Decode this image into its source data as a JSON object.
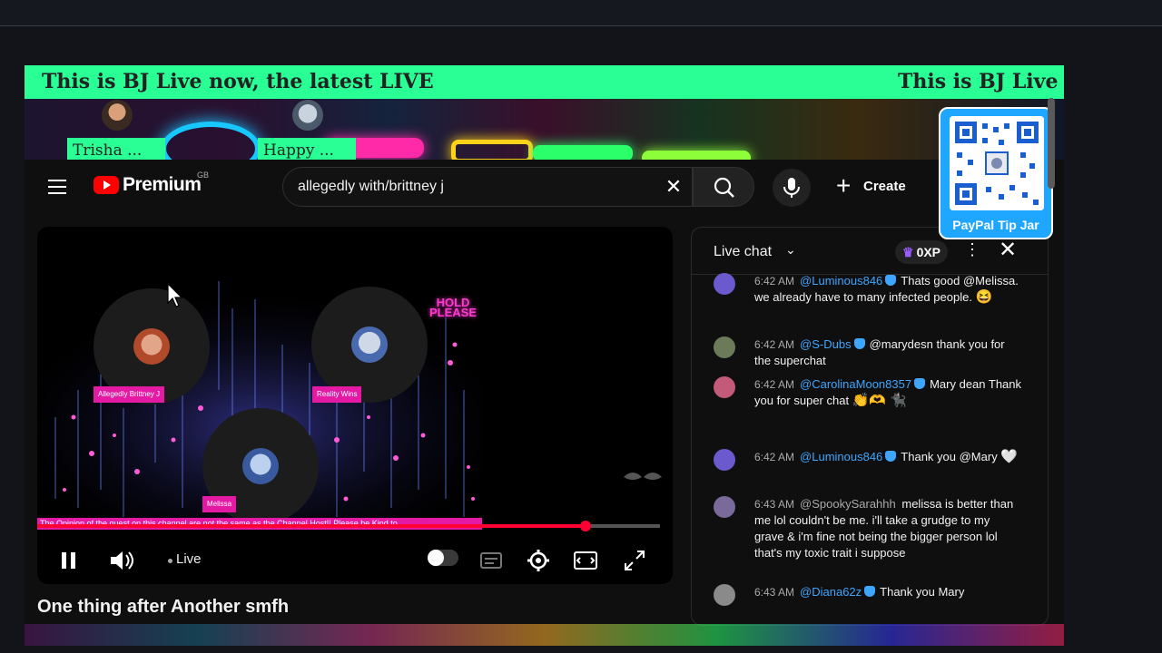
{
  "overlay": {
    "ticker_text_a": "This is BJ Live now, the latest LIVE",
    "ticker_text_b": "This is BJ Live",
    "guests_top": [
      {
        "name": "Trisha ..."
      },
      {
        "name": "Happy ..."
      }
    ],
    "qr_label": "PayPal Tip Jar"
  },
  "header": {
    "logo_text": "Premium",
    "logo_region": "GB",
    "search_value": "allegedly with/brittney j",
    "create_label": "Create"
  },
  "player": {
    "hold_text_1": "HOLD",
    "hold_text_2": "PLEASE",
    "guests": [
      {
        "tag": "Allegedly Brittney J"
      },
      {
        "tag": "Reality Wins"
      },
      {
        "tag": "Melissa"
      }
    ],
    "marquee": "The Opinion of the guest on this channel are not the same as the Channel Host!! Please be Kind to",
    "live_label": "Live",
    "progress_fraction": 0.88
  },
  "video": {
    "title": "One thing after Another smfh"
  },
  "chat": {
    "title": "Live chat",
    "xp_label": "0XP",
    "messages": [
      {
        "time": "6:42 AM",
        "author": "@Luminous846",
        "text": "Thats good @Melissa. we already have to many infected people.",
        "emoji": "😆",
        "avatar": "#6a5acd"
      },
      {
        "time": "6:42 AM",
        "author": "@S-Dubs",
        "text": "@marydesn thank you for the superchat",
        "emoji": "",
        "avatar": "#6b7b5a"
      },
      {
        "time": "6:42 AM",
        "author": "@CarolinaMoon8357",
        "text": "Mary dean Thank you for super chat",
        "emoji": "👏🫶 🐈‍⬛",
        "avatar": "#c45a7a"
      },
      {
        "time": "6:42 AM",
        "author": "@Luminous846",
        "text": "Thank you @Mary",
        "emoji": "🤍",
        "avatar": "#6a5acd"
      },
      {
        "time": "6:43 AM",
        "author": "@SpookySarahhh",
        "text": "melissa is better than me lol couldn't be me. i'll take a grudge to my grave & i'm fine not being the bigger person lol that's my toxic trait i suppose",
        "emoji": "",
        "avatar": "#7a6a9a"
      },
      {
        "time": "6:43 AM",
        "author": "@Diana62z",
        "text": "Thank you Mary",
        "emoji": "",
        "avatar": "#8a8a8a"
      }
    ]
  },
  "colors": {
    "ticker_bg": "#29ff95",
    "accent_red": "#ff0033",
    "tag_pink": "#e41aa5",
    "author_blue": "#3ea6ff"
  }
}
